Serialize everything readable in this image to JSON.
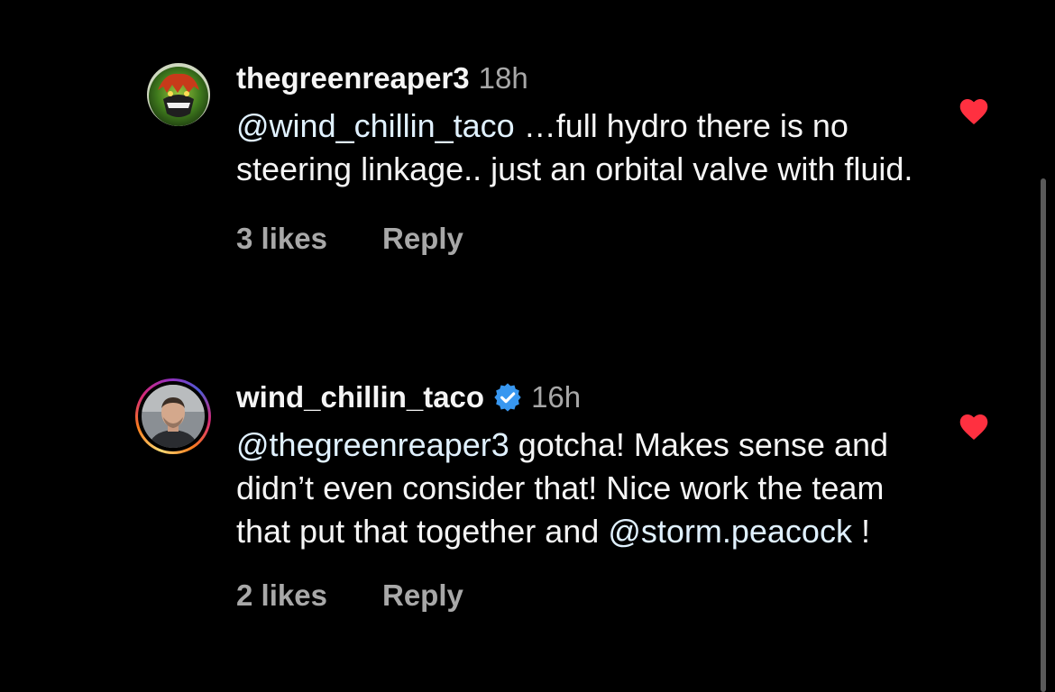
{
  "comments": [
    {
      "username": "thegreenreaper3",
      "time": "18h",
      "mention": "@wind_chillin_taco",
      "text_after": " …full hydro there is no steering linkage.. just an orbital valve with fluid.",
      "likes": "3 likes",
      "reply_label": "Reply",
      "avatar_icon": "hulk-avatar",
      "liked": true
    },
    {
      "username": "wind_chillin_taco",
      "verified": true,
      "time": "16h",
      "mention": "@thegreenreaper3",
      "text_middle": " gotcha! Makes sense and didn’t even consider that! Nice work the team that put that together and ",
      "mention2": "@storm.peacock",
      "text_after": " !",
      "likes": "2 likes",
      "reply_label": "Reply",
      "avatar_icon": "man-avatar",
      "liked": true
    }
  ],
  "colors": {
    "background": "#000000",
    "text": "#f5f5f5",
    "secondary": "#a8a8a8",
    "mention": "#e0f1ff",
    "heart": "#ff3040",
    "verified": "#3897f0"
  }
}
